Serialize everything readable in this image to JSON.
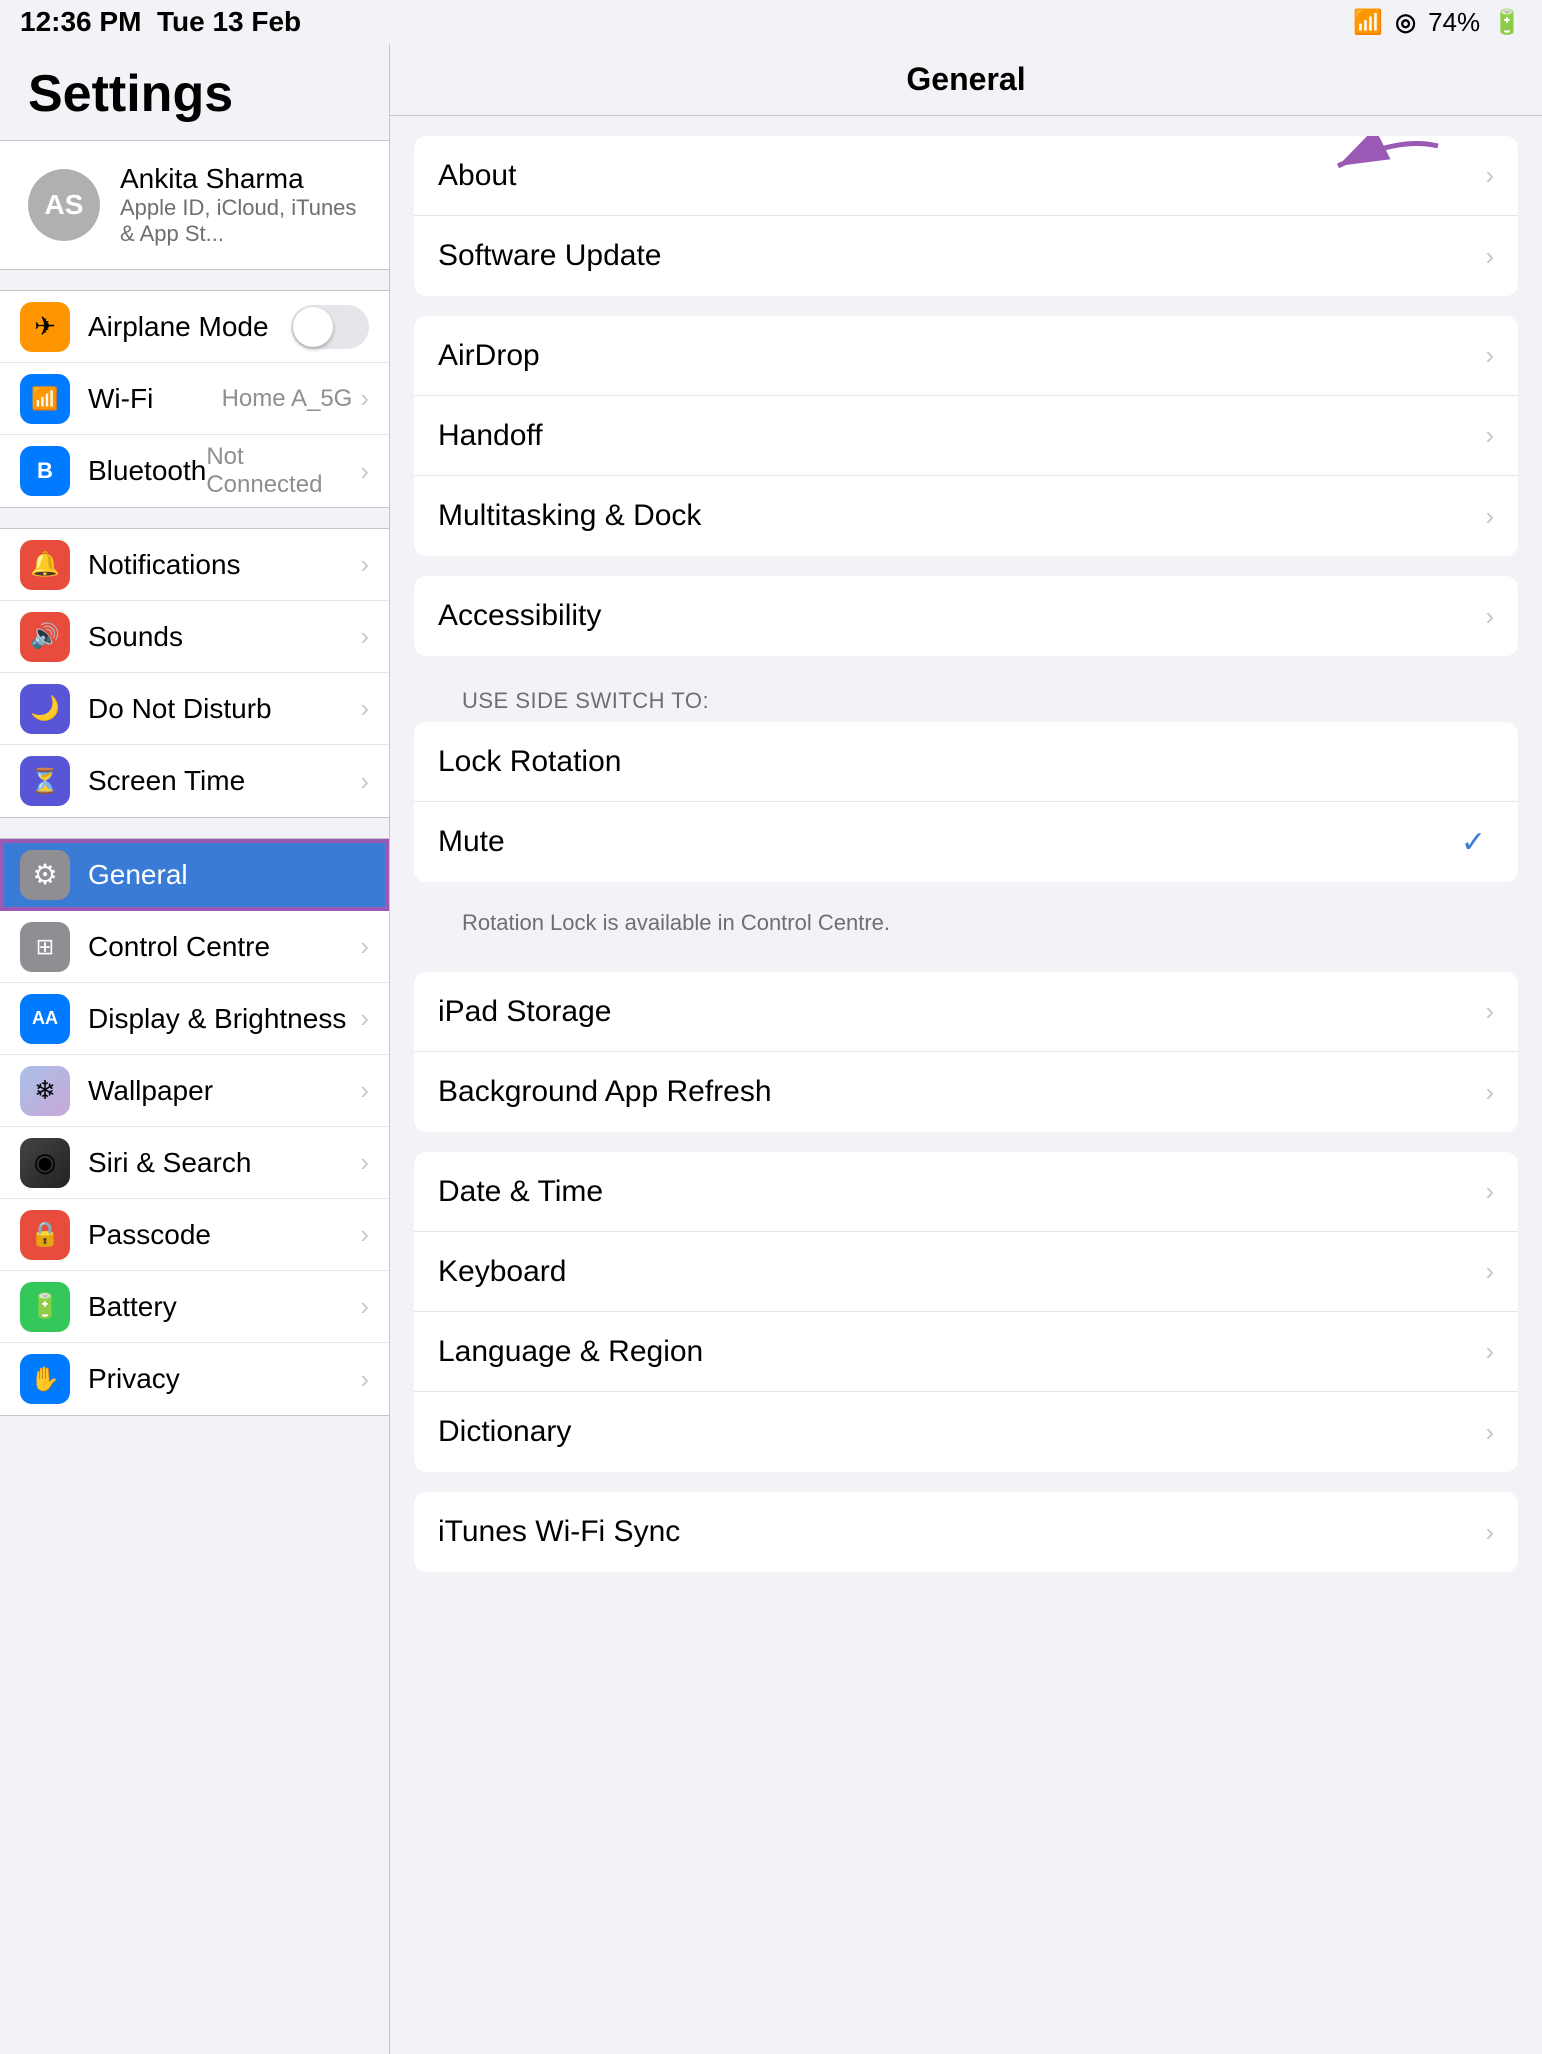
{
  "statusBar": {
    "time": "12:36 PM",
    "date": "Tue 13 Feb",
    "wifi": "wifi",
    "location": "◎",
    "battery": "74%"
  },
  "sidebar": {
    "title": "Settings",
    "user": {
      "initials": "AS",
      "name": "Ankita Sharma",
      "subtitle": "Apple ID, iCloud, iTunes & App St..."
    },
    "groups": [
      {
        "items": [
          {
            "id": "airplane",
            "label": "Airplane Mode",
            "iconBg": "icon-orange",
            "icon": "✈",
            "hasToggle": true
          },
          {
            "id": "wifi",
            "label": "Wi-Fi",
            "iconBg": "icon-blue",
            "icon": "📶",
            "value": "Home A_5G"
          },
          {
            "id": "bluetooth",
            "label": "Bluetooth",
            "iconBg": "icon-blue-bt",
            "icon": "🔵",
            "value": "Not Connected"
          }
        ]
      },
      {
        "items": [
          {
            "id": "notifications",
            "label": "Notifications",
            "iconBg": "icon-red-notif",
            "icon": "🔔"
          },
          {
            "id": "sounds",
            "label": "Sounds",
            "iconBg": "icon-red-sounds",
            "icon": "🔊"
          },
          {
            "id": "donotdisturb",
            "label": "Do Not Disturb",
            "iconBg": "icon-purple",
            "icon": "🌙"
          },
          {
            "id": "screentime",
            "label": "Screen Time",
            "iconBg": "icon-purple-screen",
            "icon": "⏳"
          }
        ]
      },
      {
        "items": [
          {
            "id": "general",
            "label": "General",
            "iconBg": "icon-gray",
            "icon": "⚙",
            "active": true
          },
          {
            "id": "controlcentre",
            "label": "Control Centre",
            "iconBg": "icon-gray-cc",
            "icon": "⊞"
          },
          {
            "id": "displaybrightness",
            "label": "Display & Brightness",
            "iconBg": "icon-blue-disp",
            "icon": "AA"
          },
          {
            "id": "wallpaper",
            "label": "Wallpaper",
            "iconBg": "icon-gray-wall",
            "icon": "❄"
          },
          {
            "id": "sirisearch",
            "label": "Siri & Search",
            "iconBg": "icon-siri",
            "icon": "◉"
          },
          {
            "id": "passcode",
            "label": "Passcode",
            "iconBg": "icon-red-pass",
            "icon": "🔒"
          },
          {
            "id": "battery",
            "label": "Battery",
            "iconBg": "icon-green-bat",
            "icon": "🔋"
          },
          {
            "id": "privacy",
            "label": "Privacy",
            "iconBg": "icon-blue-priv",
            "icon": "✋"
          }
        ]
      }
    ]
  },
  "content": {
    "title": "General",
    "arrowText": "←",
    "groups": [
      {
        "items": [
          {
            "id": "about",
            "label": "About",
            "hasChevron": true,
            "hasArrow": true
          },
          {
            "id": "softwareupdate",
            "label": "Software Update",
            "hasChevron": true
          }
        ]
      },
      {
        "items": [
          {
            "id": "airdrop",
            "label": "AirDrop",
            "hasChevron": true
          },
          {
            "id": "handoff",
            "label": "Handoff",
            "hasChevron": true
          },
          {
            "id": "multitasking",
            "label": "Multitasking & Dock",
            "hasChevron": true
          }
        ]
      },
      {
        "items": [
          {
            "id": "accessibility",
            "label": "Accessibility",
            "hasChevron": true
          }
        ]
      },
      {
        "sectionHeader": "USE SIDE SWITCH TO:",
        "items": [
          {
            "id": "lockrotation",
            "label": "Lock Rotation",
            "hasChevron": false
          },
          {
            "id": "mute",
            "label": "Mute",
            "hasChevron": false,
            "hasCheck": true
          }
        ],
        "footer": "Rotation Lock is available in Control Centre."
      },
      {
        "items": [
          {
            "id": "ipadstorage",
            "label": "iPad Storage",
            "hasChevron": true
          },
          {
            "id": "backgroundapprefresh",
            "label": "Background App Refresh",
            "hasChevron": true
          }
        ]
      },
      {
        "items": [
          {
            "id": "datetime",
            "label": "Date & Time",
            "hasChevron": true
          },
          {
            "id": "keyboard",
            "label": "Keyboard",
            "hasChevron": true
          },
          {
            "id": "languageregion",
            "label": "Language & Region",
            "hasChevron": true
          },
          {
            "id": "dictionary",
            "label": "Dictionary",
            "hasChevron": true
          }
        ]
      },
      {
        "items": [
          {
            "id": "ituneswifisync",
            "label": "iTunes Wi-Fi Sync",
            "hasChevron": true
          }
        ]
      }
    ]
  }
}
